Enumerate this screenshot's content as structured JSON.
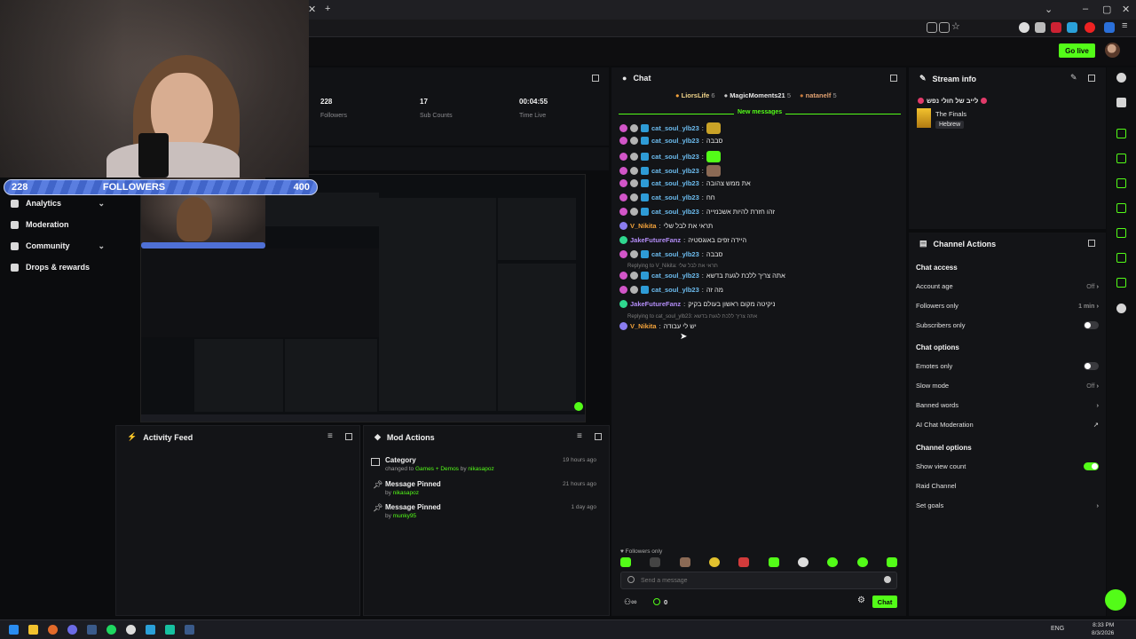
{
  "app": {
    "go_live_label": "Go live"
  },
  "overlay": {
    "followers_current": "228",
    "followers_label": "FOLLOWERS",
    "followers_goal": "400",
    "followers_progress": 0.57
  },
  "nav": [
    {
      "label": "Analytics",
      "has_chevron": true
    },
    {
      "label": "Moderation",
      "has_chevron": false
    },
    {
      "label": "Community",
      "has_chevron": true
    },
    {
      "label": "Drops & rewards",
      "has_chevron": false
    }
  ],
  "stats": [
    {
      "value": "228",
      "label": "Followers"
    },
    {
      "value": "17",
      "label": "Sub Counts"
    },
    {
      "value": "00:04:55",
      "label": "Time Live"
    }
  ],
  "activity_feed": {
    "title": "Activity Feed"
  },
  "mod_actions": {
    "title": "Mod Actions",
    "items": [
      {
        "title": "Category",
        "prefix": "changed to ",
        "highlight": "Games + Demos",
        "by": "by ",
        "user": "nikasapoz",
        "time": "19 hours ago"
      },
      {
        "title": "Message Pinned",
        "prefix": "",
        "highlight": "",
        "by": "by ",
        "user": "nikasapoz",
        "time": "21 hours ago"
      },
      {
        "title": "Message Pinned",
        "prefix": "",
        "highlight": "",
        "by": "by ",
        "user": "munky95",
        "time": "1 day ago"
      }
    ]
  },
  "chat": {
    "title": "Chat",
    "top_gifters": [
      {
        "name": "LiorsLife",
        "count": "6"
      },
      {
        "name": "MagicMoments21",
        "count": "5"
      },
      {
        "name": "natanelf",
        "count": "5"
      }
    ],
    "new_messages_label": "New messages",
    "messages": [
      {
        "user": "cat_soul_ylb23",
        "text": "",
        "emote": "#c9a227"
      },
      {
        "user": "cat_soul_ylb23",
        "text": "סבבה",
        "emote": ""
      },
      {
        "user": "cat_soul_ylb23",
        "text": "",
        "emote": "#53fc18"
      },
      {
        "user": "cat_soul_ylb23",
        "text": "",
        "emote": "#8b6a55"
      },
      {
        "user": "cat_soul_ylb23",
        "text": "את ממש צהובה",
        "emote": ""
      },
      {
        "user": "cat_soul_ylb23",
        "text": "חח",
        "emote": ""
      },
      {
        "user": "cat_soul_ylb23",
        "text": "זהו חזרת להיות אשכנזייה",
        "emote": ""
      },
      {
        "user": "V_Nikita",
        "text": "תראי את לבל שלי",
        "emote": ""
      },
      {
        "user": "JakeFutureFanz",
        "text": "היידה זפים באוגסטיה",
        "emote": ""
      },
      {
        "user": "cat_soul_ylb23",
        "text": "סבבה",
        "emote": ""
      },
      {
        "user": "cat_soul_ylb23",
        "text": "אתה צריך ללכת לגעת בדשא",
        "emote": ""
      },
      {
        "user": "cat_soul_ylb23",
        "text": "מה זה",
        "emote": ""
      },
      {
        "user": "JakeFutureFanz",
        "text": "ניקיטה מקום ראשון בעולם בקיק",
        "emote": ""
      },
      {
        "user": "V_Nikita",
        "text": "יש לי עבודה",
        "emote": ""
      }
    ],
    "replies": [
      {
        "text": "Replying to V_Nikita: תראי את לבל שלי"
      },
      {
        "text": "Replying to cat_soul_ylb23: אתה צריך ללכת לגעת בדשא"
      }
    ],
    "followers_only_label": "Followers only",
    "input_placeholder": "Send a message",
    "viewer_count": "0",
    "send_label": "Chat"
  },
  "stream_info": {
    "title": "Stream info",
    "stream_title": "לייב של חולי נפש",
    "category": "The Finals",
    "language": "Hebrew"
  },
  "channel_actions": {
    "title": "Channel Actions",
    "sections": [
      {
        "heading": "Chat access",
        "rows": [
          {
            "label": "Account age",
            "value": "Off",
            "control": "chevron"
          },
          {
            "label": "Followers only",
            "value": "1 min",
            "control": "chevron",
            "accent": true
          },
          {
            "label": "Subscribers only",
            "value": "",
            "control": "toggle-off"
          }
        ]
      },
      {
        "heading": "Chat options",
        "rows": [
          {
            "label": "Emotes only",
            "value": "",
            "control": "toggle-off"
          },
          {
            "label": "Slow mode",
            "value": "Off",
            "control": "chevron"
          },
          {
            "label": "Banned words",
            "value": "",
            "control": "chevron"
          },
          {
            "label": "AI Chat Moderation",
            "value": "",
            "control": "external"
          }
        ]
      },
      {
        "heading": "Channel options",
        "rows": [
          {
            "label": "Show view count",
            "value": "",
            "control": "toggle-on"
          },
          {
            "label": "Raid Channel",
            "value": "",
            "control": "none"
          },
          {
            "label": "Set goals",
            "value": "",
            "control": "chevron"
          }
        ]
      }
    ]
  },
  "taskbar": {
    "lang": "ENG",
    "time": "8:33 PM",
    "date": "8/3/2026"
  },
  "colors": {
    "accent": "#53fc18",
    "panel": "#131417",
    "bg": "#0b0c0e"
  }
}
